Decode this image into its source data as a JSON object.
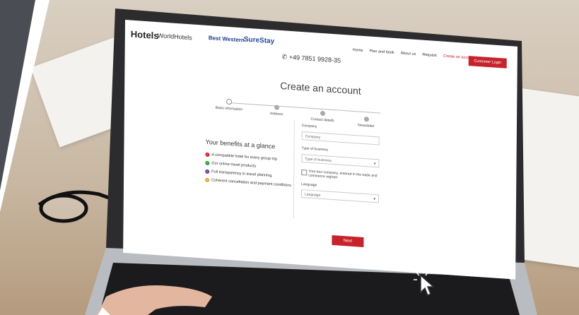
{
  "nav": {
    "brand": "Hotels",
    "logos": [
      "WorldHotels",
      "Best Western",
      "SureStay"
    ],
    "phone": "+49 7851 9928-35",
    "menu": [
      "Home",
      "Plan and book",
      "About us",
      "Request",
      "Create an account"
    ],
    "login": "Customer Login"
  },
  "page": {
    "title": "Create an account",
    "steps": [
      "Basic information",
      "Address",
      "Contact details",
      "Newsletter"
    ]
  },
  "benefits": {
    "title": "Your benefits at a glance",
    "items": [
      {
        "text": "A compatible hotel for every group trip",
        "color": "#d2232a"
      },
      {
        "text": "Our online travel products",
        "color": "#2f9a41"
      },
      {
        "text": "Full transparency in travel planning",
        "color": "#6a3d9a"
      },
      {
        "text": "Coherent cancellation and payment conditions",
        "color": "#f0a030"
      }
    ]
  },
  "form": {
    "company_label": "Company",
    "company_placeholder": "Company",
    "business_label": "Type of business",
    "business_value": "Type of business",
    "checkbox_label": "Your tour company, entered in the trade and commerce register",
    "language_label": "Language",
    "language_value": "Language",
    "next_label": "Next"
  }
}
